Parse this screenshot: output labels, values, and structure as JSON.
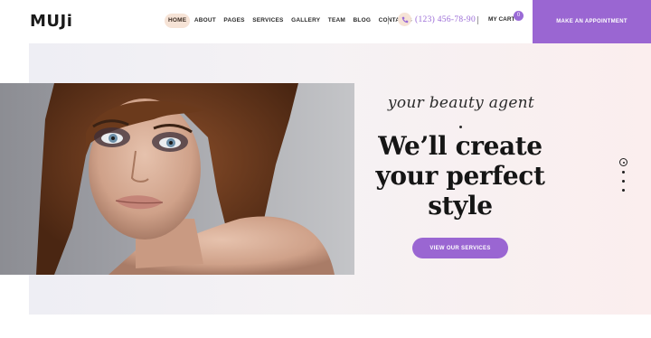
{
  "brand": {
    "logo_text": "MUJi"
  },
  "nav": {
    "items": [
      {
        "label": "HOME",
        "active": true
      },
      {
        "label": "ABOUT",
        "active": false
      },
      {
        "label": "PAGES",
        "active": false
      },
      {
        "label": "SERVICES",
        "active": false
      },
      {
        "label": "GALLERY",
        "active": false
      },
      {
        "label": "TEAM",
        "active": false
      },
      {
        "label": "BLOG",
        "active": false
      },
      {
        "label": "CONTACTS",
        "active": false
      }
    ]
  },
  "contact": {
    "phone": "(123) 456-78-90",
    "phone_icon": "phone-icon"
  },
  "cart": {
    "label": "MY CART",
    "count": "0"
  },
  "appointment": {
    "label": "MAKE AN APPOINTMENT"
  },
  "hero": {
    "tagline": "your beauty agent",
    "headline_line1": "We’ll create",
    "headline_line2": "your perfect",
    "headline_line3": "style",
    "cta_label": "VIEW OUR SERVICES",
    "slider": {
      "count": 4,
      "active_index": 0
    }
  },
  "colors": {
    "accent": "#9a66d2",
    "nav_active_bg": "#f6e3d6",
    "hero_bg_start": "#eeeef4",
    "hero_bg_end": "#fbeeee"
  }
}
